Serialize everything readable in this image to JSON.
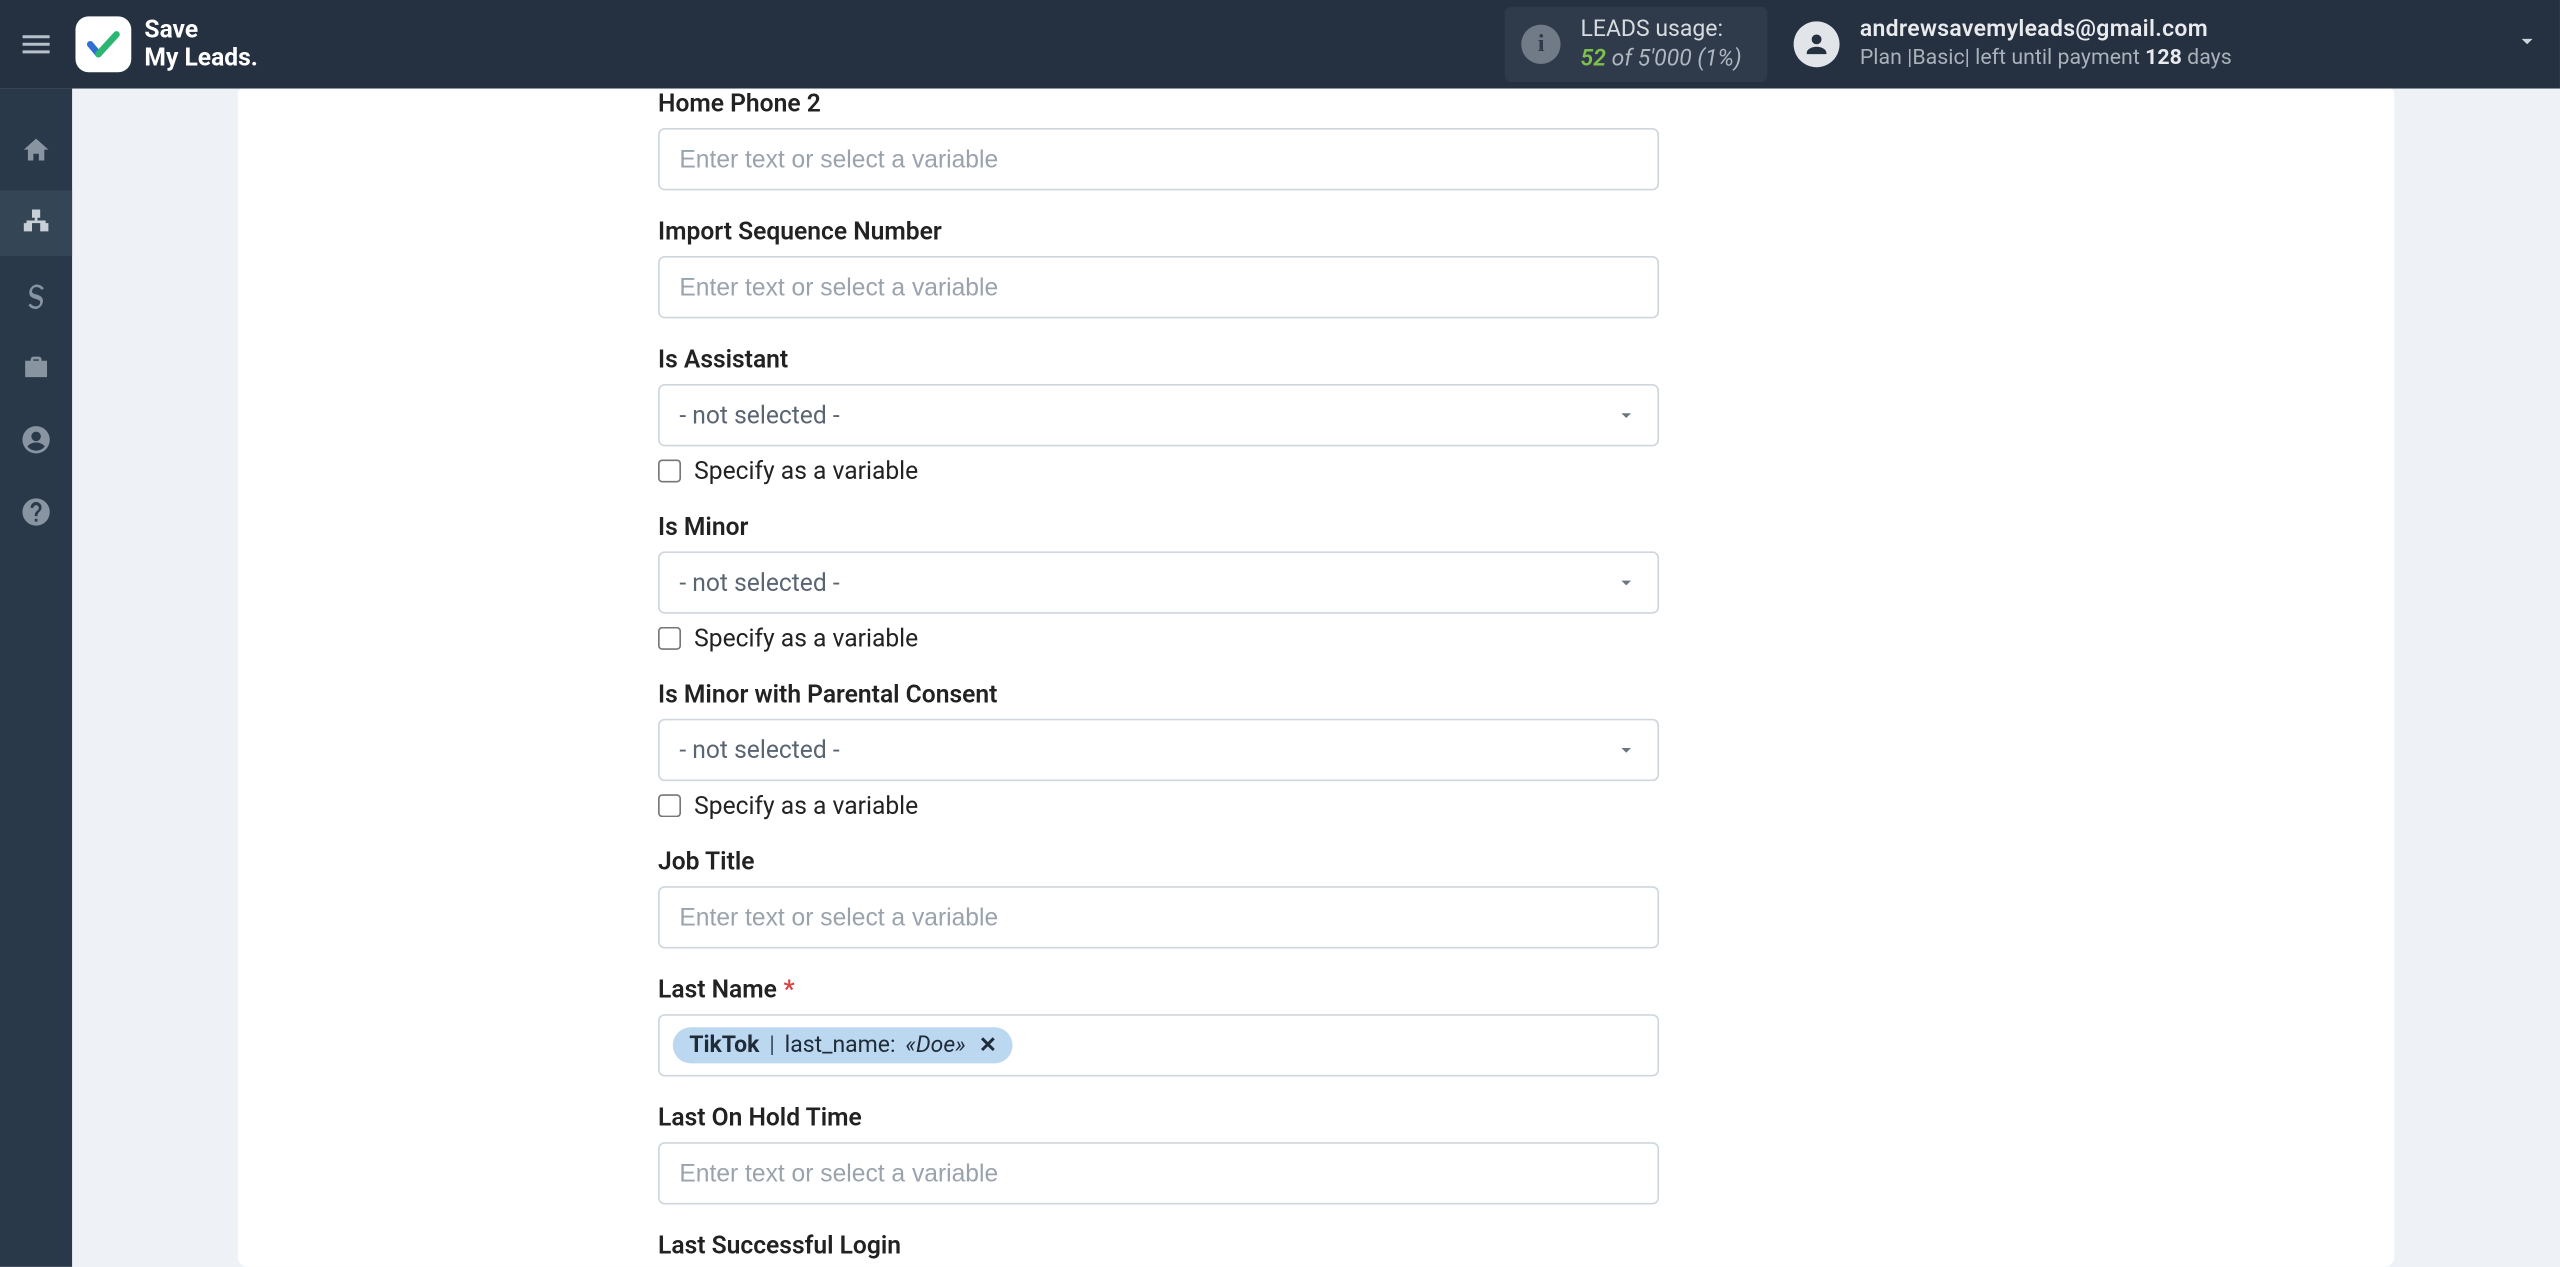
{
  "header": {
    "logo_line1": "Save",
    "logo_line2": "My Leads.",
    "usage": {
      "label": "LEADS usage:",
      "used": "52",
      "of_word": "of",
      "total": "5'000",
      "pct": "(1%)"
    },
    "user": {
      "email": "andrewsavemyleads@gmail.com",
      "plan_prefix": "Plan |",
      "plan_name": "Basic",
      "plan_mid": "| left until payment",
      "days": "128",
      "days_word": "days"
    }
  },
  "form": {
    "placeholder": "Enter text or select a variable",
    "not_selected": "- not selected -",
    "specify_var": "Specify as a variable",
    "fields": {
      "home_phone_2": "Home Phone 2",
      "import_seq": "Import Sequence Number",
      "is_assistant": "Is Assistant",
      "is_minor": "Is Minor",
      "is_minor_consent": "Is Minor with Parental Consent",
      "job_title": "Job Title",
      "last_name": "Last Name",
      "last_on_hold": "Last On Hold Time",
      "last_login": "Last Successful Login"
    },
    "last_name_pill": {
      "source": "TikTok",
      "key": "last_name:",
      "example": "«Doe»"
    }
  }
}
